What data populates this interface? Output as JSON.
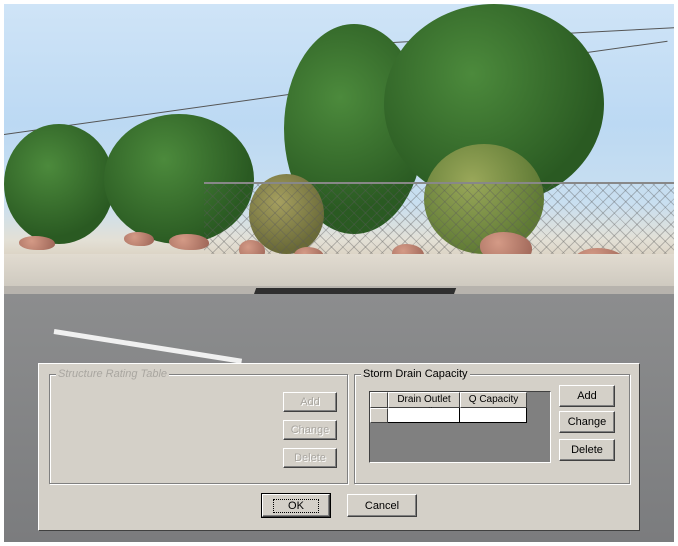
{
  "dialog": {
    "structure_rating": {
      "title": "Structure Rating Table",
      "add_label": "Add",
      "change_label": "Change",
      "delete_label": "Delete"
    },
    "storm_drain": {
      "title": "Storm Drain Capacity",
      "columns": [
        "Drain Outlet Cell",
        "Q Capacity"
      ],
      "rows": [
        [
          "",
          ""
        ]
      ],
      "add_label": "Add",
      "change_label": "Change",
      "delete_label": "Delete"
    },
    "ok_label": "OK",
    "cancel_label": "Cancel"
  },
  "colors": {
    "dialog_face": "#d4d0c8",
    "grid_background": "#808080",
    "disabled_text": "#a9a6a0"
  }
}
